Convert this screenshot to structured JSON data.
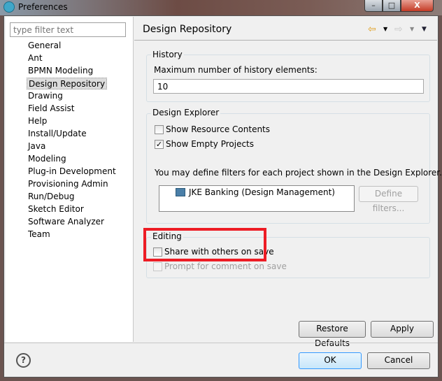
{
  "window": {
    "title": "Preferences",
    "minimize": "–",
    "maximize": "□",
    "close": "X"
  },
  "sidebar": {
    "filter_placeholder": "type filter text",
    "items": [
      {
        "label": "General"
      },
      {
        "label": "Ant"
      },
      {
        "label": "BPMN Modeling"
      },
      {
        "label": "Design Repository",
        "selected": true
      },
      {
        "label": "Drawing"
      },
      {
        "label": "Field Assist"
      },
      {
        "label": "Help"
      },
      {
        "label": "Install/Update"
      },
      {
        "label": "Java"
      },
      {
        "label": "Modeling"
      },
      {
        "label": "Plug-in Development"
      },
      {
        "label": "Provisioning Admin"
      },
      {
        "label": "Run/Debug"
      },
      {
        "label": "Sketch Editor"
      },
      {
        "label": "Software Analyzer"
      },
      {
        "label": "Team"
      }
    ]
  },
  "page": {
    "title": "Design Repository",
    "history": {
      "label": "History",
      "field_label": "Maximum number of history elements:",
      "value": "10"
    },
    "explorer": {
      "label": "Design Explorer",
      "show_resource_contents": {
        "label": "Show Resource Contents",
        "checked": false
      },
      "show_empty_projects": {
        "label": "Show Empty Projects",
        "checked": true
      },
      "hint": "You may define filters for each project shown in the Design Explorer.",
      "projects": [
        "JKE Banking (Design Management)"
      ],
      "define_filters": "Define filters..."
    },
    "editing": {
      "label": "Editing",
      "share": {
        "label": "Share with others on save",
        "checked": false
      },
      "prompt": {
        "label": "Prompt for comment on save",
        "checked": false,
        "enabled": false
      }
    },
    "restore_defaults": "Restore Defaults",
    "apply": "Apply"
  },
  "footer": {
    "help": "?",
    "ok": "OK",
    "cancel": "Cancel"
  },
  "colors": {
    "highlight": "#ed1c24",
    "accent": "#3399ff"
  }
}
